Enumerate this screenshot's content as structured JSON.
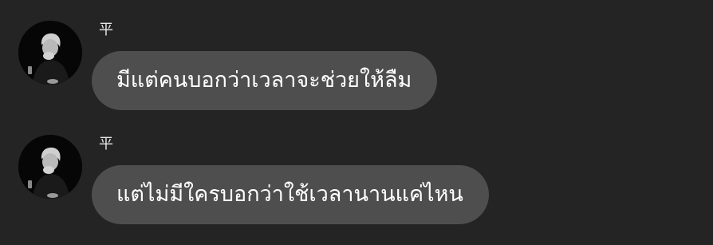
{
  "messages": [
    {
      "sender": "平",
      "text": "มีแต่คนบอกว่าเวลาจะช่วยให้ลืม"
    },
    {
      "sender": "平",
      "text": "แต่ไม่มีใครบอกว่าใช้เวลานานแค่ไหน"
    }
  ],
  "colors": {
    "background": "#242424",
    "bubble": "#4e4e4e",
    "text": "#ffffff"
  }
}
